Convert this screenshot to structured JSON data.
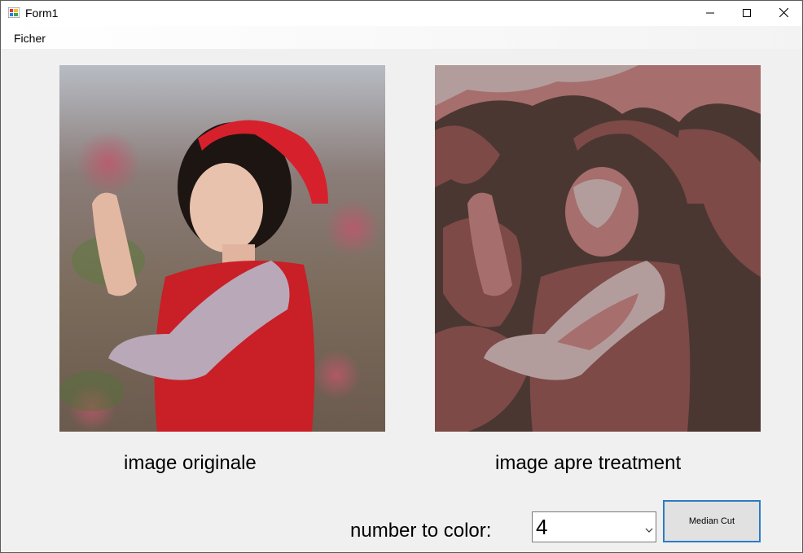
{
  "window": {
    "title": "Form1"
  },
  "menu": {
    "items": [
      {
        "label": "Ficher"
      }
    ]
  },
  "images": {
    "original_caption": "image originale",
    "treated_caption": "image apre treatment"
  },
  "controls": {
    "number_label": "number to color:",
    "number_value": "4",
    "median_cut_label": "Median Cut"
  },
  "colors": {
    "button_border": "#2c7bc6",
    "palette": [
      "#4b3732",
      "#7d4a48",
      "#a66e6c",
      "#b39d9c"
    ]
  },
  "icons": [
    "app-icon",
    "minimize-icon",
    "maximize-icon",
    "close-icon",
    "chevron-down-icon"
  ]
}
